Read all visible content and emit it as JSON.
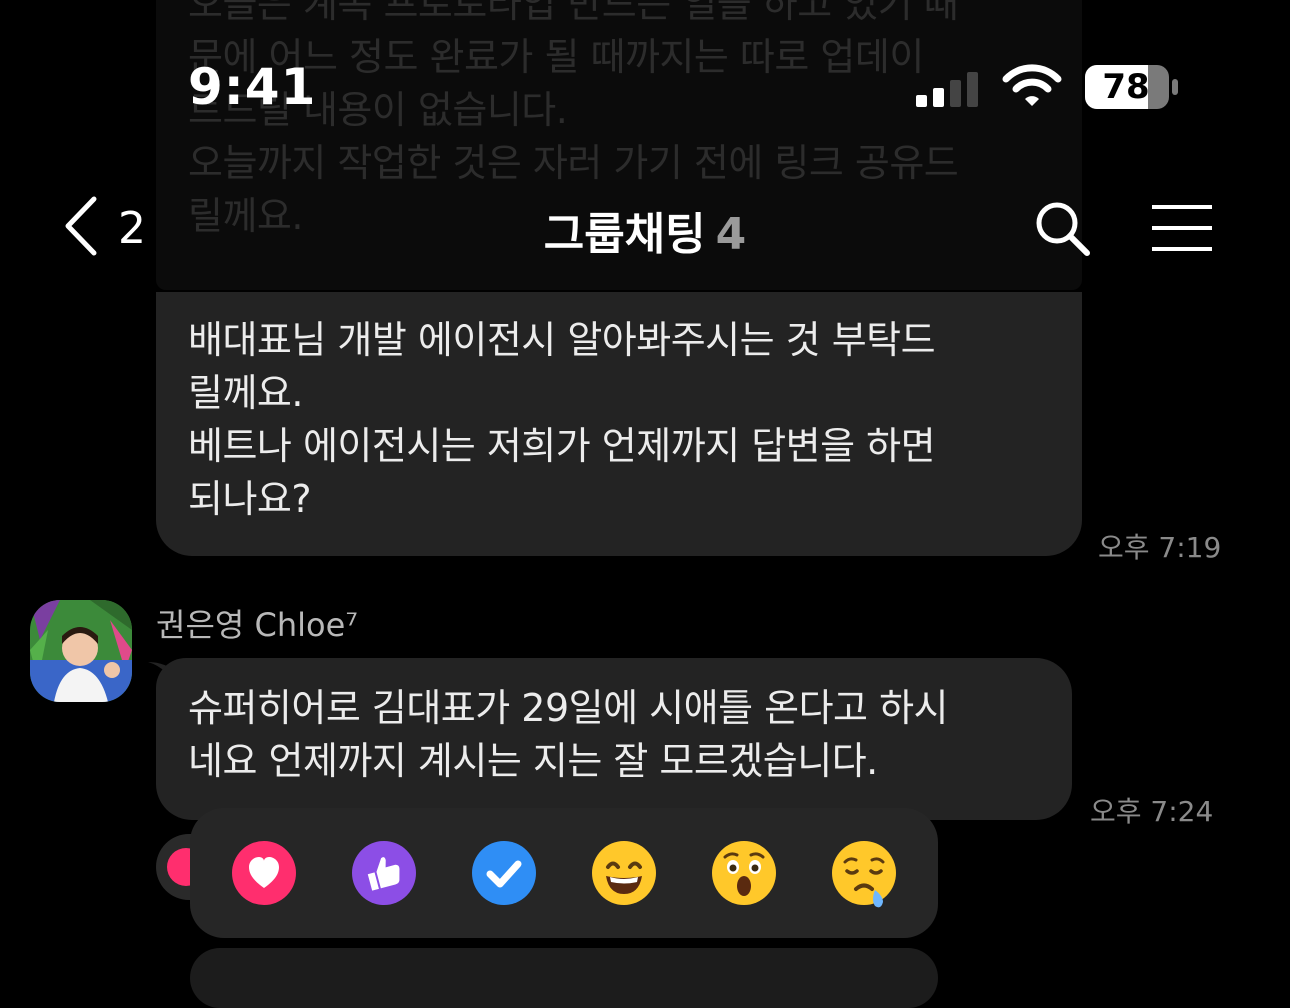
{
  "status_bar": {
    "time": "9:41",
    "battery": "78"
  },
  "header": {
    "back_count": "2",
    "title": "그룹채팅",
    "member_count": "4"
  },
  "faded_message": {
    "lines": [
      "오늘은 계속 프로토타입 만드는 일을 하고 있기 때",
      "문에 어느 정도 완료가 될 때까지는 따로 업데이",
      "트드릴 내용이 없습니다.",
      "오늘까지 작업한 것은 자러 가기 전에 링크 공유드",
      "릴께요."
    ]
  },
  "message_1": {
    "lines": [
      "배대표님 개발 에이전시 알아봐주시는 것 부탁드",
      "릴께요.",
      "베트나 에이전시는 저희가 언제까지 답변을 하면",
      "되나요?"
    ],
    "time": "오후 7:19"
  },
  "message_2": {
    "sender": "권은영 Chloe⁷",
    "lines": [
      "슈퍼히어로 김대표가 29일에 시애틀 온다고 하시",
      "네요 언제까지 계시는 지는 잘 모르겠습니다."
    ],
    "time": "오후 7:24"
  },
  "reactions": [
    "heart-icon",
    "thumbs-up-icon",
    "check-icon",
    "grin-emoji",
    "surprised-emoji",
    "sad-tear-emoji"
  ],
  "colors": {
    "heart": "#ff2e6e",
    "thumbs": "#8c4ee6",
    "check": "#2f8ef5",
    "emoji_yellow": "#ffc82a"
  }
}
